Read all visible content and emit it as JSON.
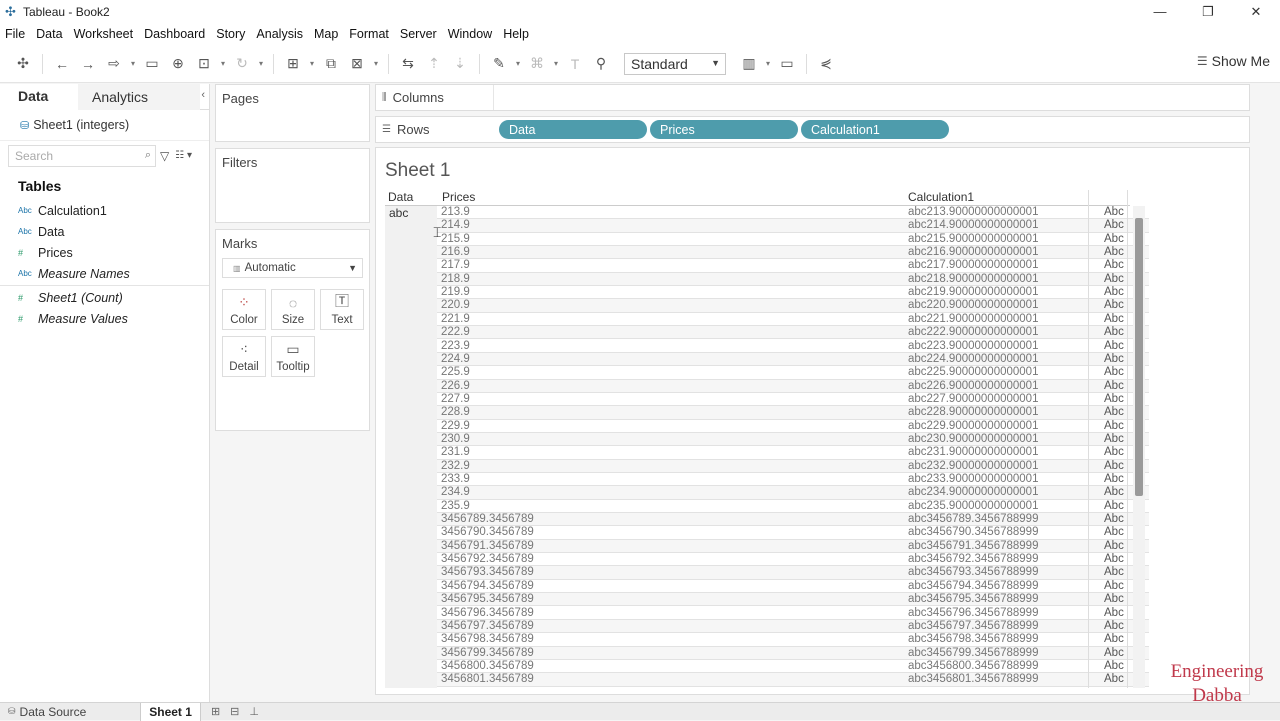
{
  "window": {
    "title": "Tableau - Book2"
  },
  "menu": [
    "File",
    "Data",
    "Worksheet",
    "Dashboard",
    "Story",
    "Analysis",
    "Map",
    "Format",
    "Server",
    "Window",
    "Help"
  ],
  "toolbar": {
    "fit_select": "Standard",
    "show_me": "Show Me"
  },
  "left_pane": {
    "tab_data": "Data",
    "tab_analytics": "Analytics",
    "datasource": "Sheet1 (integers)",
    "search_placeholder": "Search",
    "tables_heading": "Tables",
    "fields": [
      {
        "name": "Calculation1",
        "type": "Abc"
      },
      {
        "name": "Data",
        "type": "Abc"
      },
      {
        "name": "Prices",
        "type": "#"
      },
      {
        "name": "Measure Names",
        "type": "Abc"
      },
      {
        "name": "Sheet1 (Count)",
        "type": "#"
      },
      {
        "name": "Measure Values",
        "type": "#"
      }
    ]
  },
  "cards": {
    "pages": "Pages",
    "filters": "Filters",
    "marks": "Marks",
    "marks_type": "Automatic",
    "buttons": [
      "Color",
      "Size",
      "Text",
      "Detail",
      "Tooltip"
    ]
  },
  "shelves": {
    "columns_label": "Columns",
    "rows_label": "Rows",
    "row_pills": [
      "Data",
      "Prices",
      "Calculation1"
    ]
  },
  "sheet": {
    "title": "Sheet 1",
    "headers": {
      "data": "Data",
      "prices": "Prices",
      "calc": "Calculation1"
    },
    "data_value": "abc",
    "rows": [
      [
        "213.9",
        "abc213.90000000000001",
        "Abc"
      ],
      [
        "214.9",
        "abc214.90000000000001",
        "Abc"
      ],
      [
        "215.9",
        "abc215.90000000000001",
        "Abc"
      ],
      [
        "216.9",
        "abc216.90000000000001",
        "Abc"
      ],
      [
        "217.9",
        "abc217.90000000000001",
        "Abc"
      ],
      [
        "218.9",
        "abc218.90000000000001",
        "Abc"
      ],
      [
        "219.9",
        "abc219.90000000000001",
        "Abc"
      ],
      [
        "220.9",
        "abc220.90000000000001",
        "Abc"
      ],
      [
        "221.9",
        "abc221.90000000000001",
        "Abc"
      ],
      [
        "222.9",
        "abc222.90000000000001",
        "Abc"
      ],
      [
        "223.9",
        "abc223.90000000000001",
        "Abc"
      ],
      [
        "224.9",
        "abc224.90000000000001",
        "Abc"
      ],
      [
        "225.9",
        "abc225.90000000000001",
        "Abc"
      ],
      [
        "226.9",
        "abc226.90000000000001",
        "Abc"
      ],
      [
        "227.9",
        "abc227.90000000000001",
        "Abc"
      ],
      [
        "228.9",
        "abc228.90000000000001",
        "Abc"
      ],
      [
        "229.9",
        "abc229.90000000000001",
        "Abc"
      ],
      [
        "230.9",
        "abc230.90000000000001",
        "Abc"
      ],
      [
        "231.9",
        "abc231.90000000000001",
        "Abc"
      ],
      [
        "232.9",
        "abc232.90000000000001",
        "Abc"
      ],
      [
        "233.9",
        "abc233.90000000000001",
        "Abc"
      ],
      [
        "234.9",
        "abc234.90000000000001",
        "Abc"
      ],
      [
        "235.9",
        "abc235.90000000000001",
        "Abc"
      ],
      [
        "3456789.3456789",
        "abc3456789.3456788999",
        "Abc"
      ],
      [
        "3456790.3456789",
        "abc3456790.3456788999",
        "Abc"
      ],
      [
        "3456791.3456789",
        "abc3456791.3456788999",
        "Abc"
      ],
      [
        "3456792.3456789",
        "abc3456792.3456788999",
        "Abc"
      ],
      [
        "3456793.3456789",
        "abc3456793.3456788999",
        "Abc"
      ],
      [
        "3456794.3456789",
        "abc3456794.3456788999",
        "Abc"
      ],
      [
        "3456795.3456789",
        "abc3456795.3456788999",
        "Abc"
      ],
      [
        "3456796.3456789",
        "abc3456796.3456788999",
        "Abc"
      ],
      [
        "3456797.3456789",
        "abc3456797.3456788999",
        "Abc"
      ],
      [
        "3456798.3456789",
        "abc3456798.3456788999",
        "Abc"
      ],
      [
        "3456799.3456789",
        "abc3456799.3456788999",
        "Abc"
      ],
      [
        "3456800.3456789",
        "abc3456800.3456788999",
        "Abc"
      ],
      [
        "3456801.3456789",
        "abc3456801.3456788999",
        "Abc"
      ]
    ]
  },
  "bottom_tabs": {
    "data_source": "Data Source",
    "sheet1": "Sheet 1"
  },
  "watermark": {
    "line1": "Engineering",
    "line2": "Dabba"
  }
}
